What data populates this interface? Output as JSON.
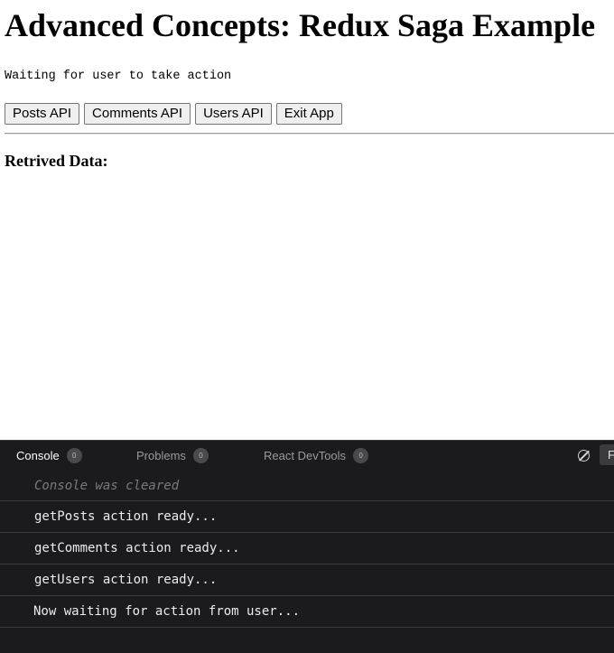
{
  "page": {
    "title": "Advanced Concepts: Redux Saga Example",
    "status": "Waiting for user to take action",
    "buttons": [
      {
        "label": "Posts API"
      },
      {
        "label": "Comments API"
      },
      {
        "label": "Users API"
      },
      {
        "label": "Exit App"
      }
    ],
    "data_heading": "Retrived Data:"
  },
  "devtools": {
    "tabs": [
      {
        "label": "Console",
        "count": "0",
        "active": true
      },
      {
        "label": "Problems",
        "count": "0",
        "active": false
      },
      {
        "label": "React DevTools",
        "count": "0",
        "active": false
      }
    ],
    "clear_icon": "clear-console-icon",
    "filter_stub": "F",
    "console_lines": [
      {
        "text": "Console was cleared",
        "kind": "info"
      },
      {
        "text": "getPosts action ready...",
        "kind": "log"
      },
      {
        "text": "getComments action ready...",
        "kind": "log"
      },
      {
        "text": "getUsers action ready...",
        "kind": "log"
      },
      {
        "text": "Now waiting for action from user...",
        "kind": "log"
      }
    ]
  },
  "colors": {
    "devtools_bg": "#1b1b1d",
    "row_divider": "#3a3a3c",
    "cleared_text": "#7a7a7d"
  }
}
